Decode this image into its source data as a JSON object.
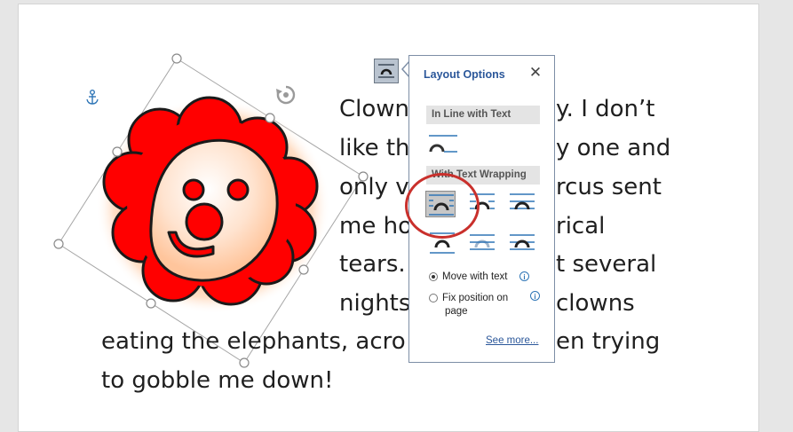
{
  "document": {
    "lines": [
      "Clown",
      "y. I don’t",
      "like th",
      "y one and",
      "only v",
      "rcus sent",
      "me ho",
      "rical",
      "tears.",
      "t several",
      "nights",
      "clowns",
      "eating the elephants, acro",
      "en trying",
      "to gobble me down!"
    ]
  },
  "layout_options": {
    "title": "Layout Options",
    "close_glyph": "✕",
    "inline_header": "In Line with Text",
    "wrapping_header": "With Text Wrapping",
    "selected_option": "square",
    "move_with_text": "Move with text",
    "fix_position": "Fix position on page",
    "fix_position_line1": "Fix position on",
    "fix_position_line2": "page",
    "see_more": "See more..."
  },
  "colors": {
    "clown_red": "#ff0000",
    "glow": "#ff9f5a",
    "accent_blue": "#2b579a",
    "highlight": "#c9302c"
  }
}
